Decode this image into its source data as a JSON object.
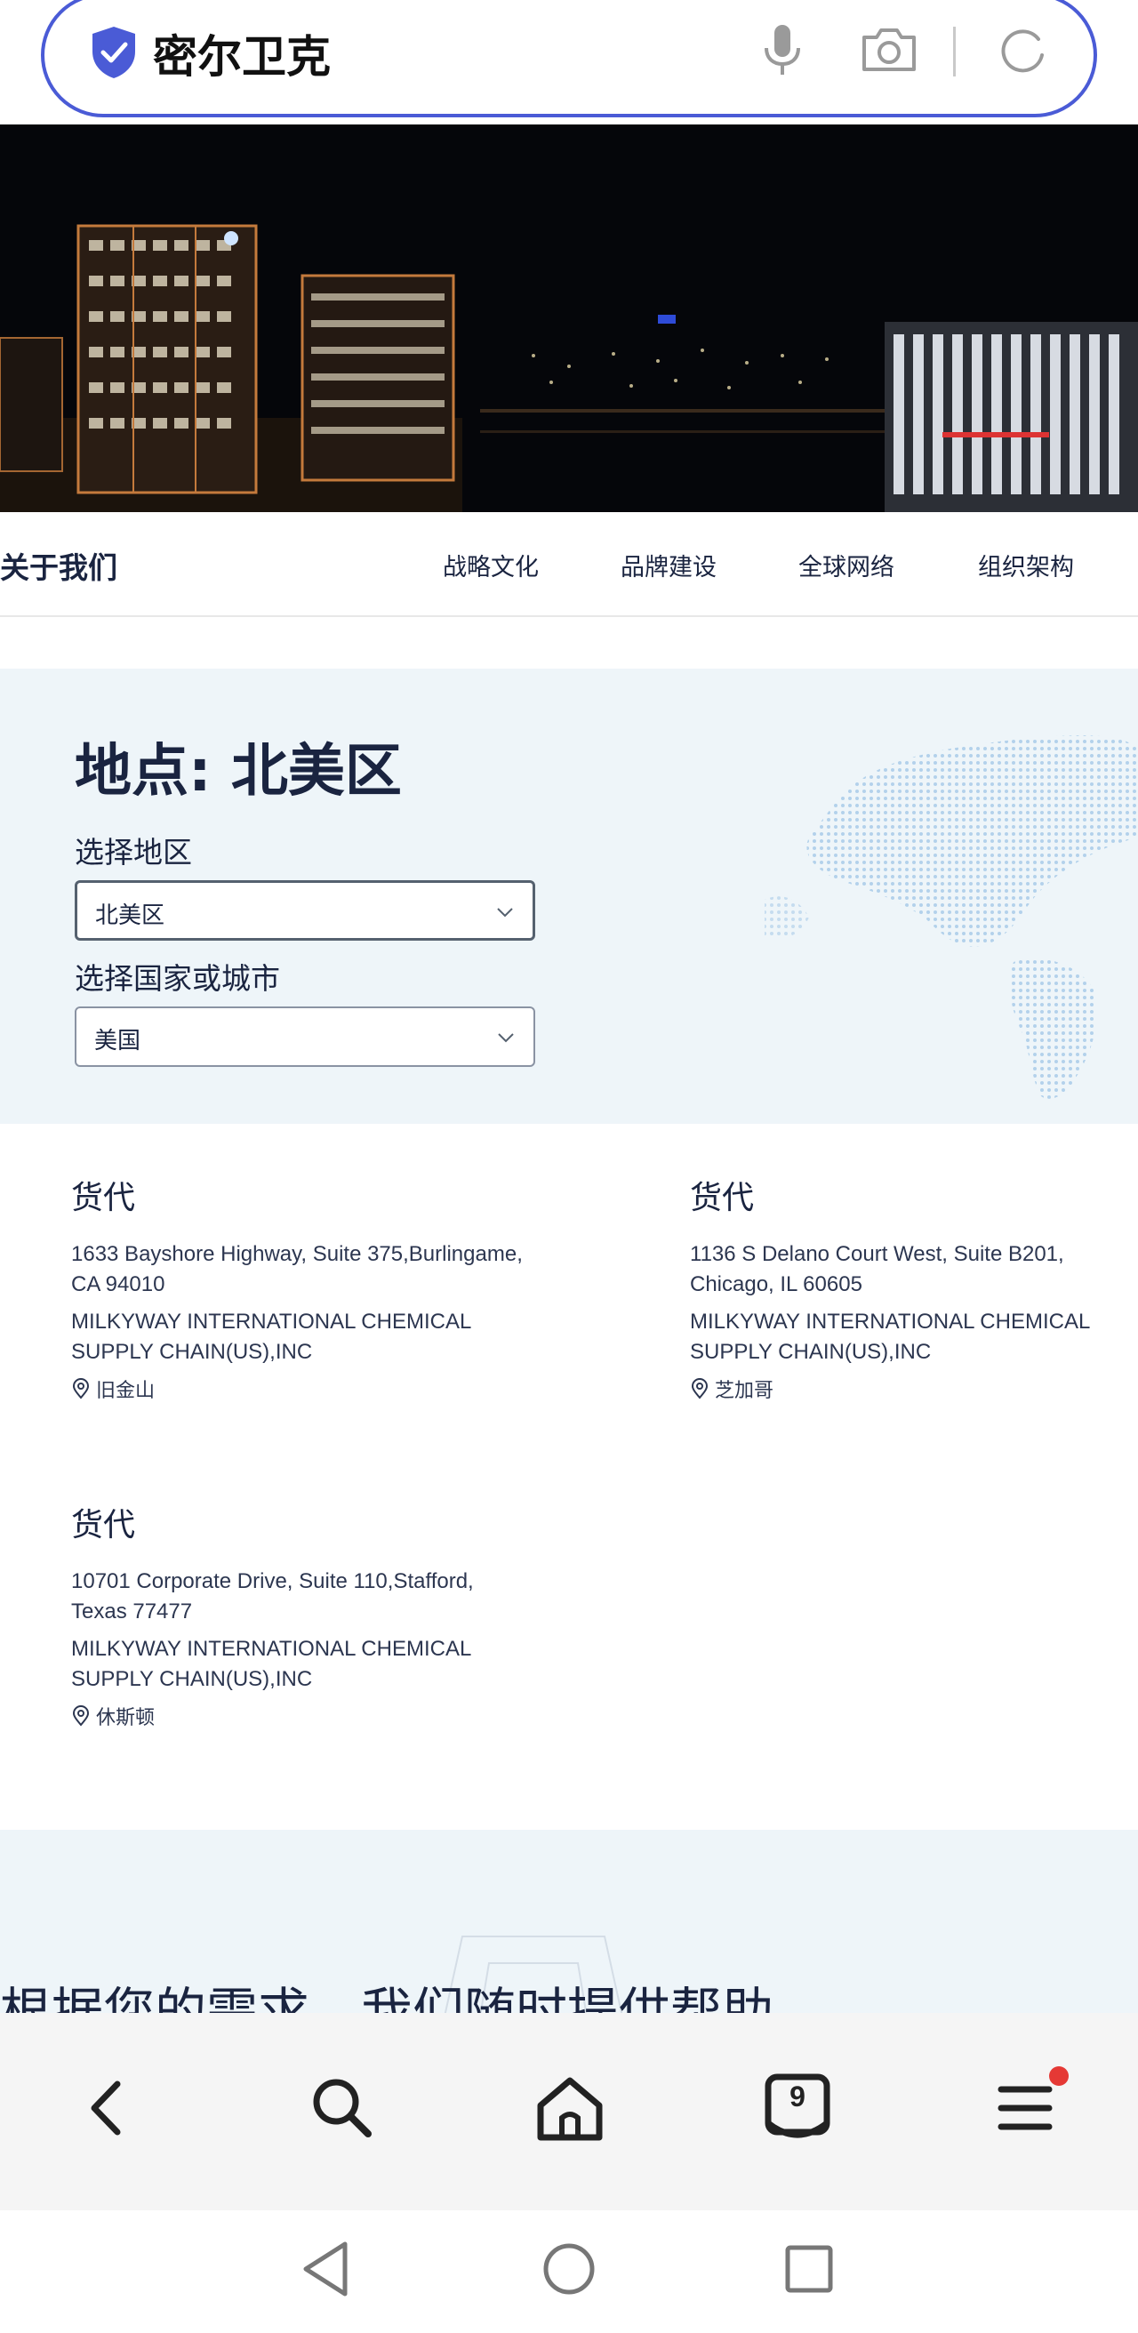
{
  "search": {
    "query": "密尔卫克"
  },
  "nav": {
    "title": "关于我们",
    "items": [
      {
        "label": "战略文化"
      },
      {
        "label": "品牌建设"
      },
      {
        "label": "全球网络"
      },
      {
        "label": "组织架构"
      }
    ]
  },
  "region": {
    "title": "地点: 北美区",
    "region_label": "选择地区",
    "region_value": "北美区",
    "country_label": "选择国家或城市",
    "country_value": "美国"
  },
  "offices": [
    {
      "type": "货代",
      "address": "1633 Bayshore Highway, Suite 375,Burlingame, CA 94010",
      "company": "MILKYWAY INTERNATIONAL CHEMICAL SUPPLY CHAIN(US),INC",
      "city": "旧金山"
    },
    {
      "type": "货代",
      "address": "1136 S Delano Court West, Suite B201, Chicago, IL 60605",
      "company": "MILKYWAY INTERNATIONAL CHEMICAL SUPPLY CHAIN(US),INC",
      "city": "芝加哥"
    },
    {
      "type": "货代",
      "address": "10701 Corporate Drive, Suite 110,Stafford, Texas 77477",
      "company": "MILKYWAY INTERNATIONAL CHEMICAL SUPPLY CHAIN(US),INC",
      "city": "休斯顿"
    }
  ],
  "help": {
    "text": "根据您的需求，我们随时提供帮助"
  },
  "browser": {
    "tabs_count": "9"
  },
  "colors": {
    "accent": "#4a5bd6",
    "badge": "#e53935",
    "section_bg": "#eef5f9"
  }
}
